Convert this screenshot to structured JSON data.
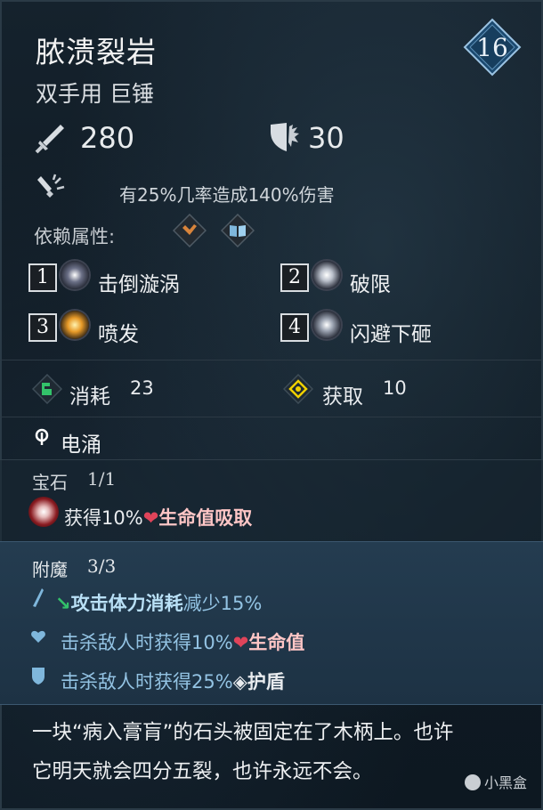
{
  "item": {
    "name": "脓溃裂岩",
    "type": "双手用 巨锤",
    "level": "16",
    "damage": "280",
    "guard": "30",
    "effect_text": "有25%几率造成140%伤害",
    "dependency_label": "依赖属性:",
    "dependency_icons": [
      "strength-icon",
      "book-icon"
    ]
  },
  "skills": [
    {
      "num": "1",
      "name": "击倒漩涡",
      "icon": "vortex-icon"
    },
    {
      "num": "2",
      "name": "破限",
      "icon": "limit-break-icon"
    },
    {
      "num": "3",
      "name": "喷发",
      "icon": "eruption-icon"
    },
    {
      "num": "4",
      "name": "闪避下砸",
      "icon": "dodge-slam-icon"
    }
  ],
  "resources": {
    "cost_label": "消耗",
    "cost_value": "23",
    "gain_label": "获取",
    "gain_value": "10"
  },
  "perk": {
    "name": "电涌",
    "icon": "surge-icon"
  },
  "gem": {
    "label": "宝石",
    "count": "1/1",
    "effect_prefix": "获得10%",
    "effect_highlight": "生命值吸取"
  },
  "enchant": {
    "label": "附魔",
    "count": "3/3",
    "lines": [
      {
        "highlight": "攻击体力消耗",
        "suffix": "减少15%"
      },
      {
        "prefix": "击杀敌人时获得10%",
        "highlight": "生命值"
      },
      {
        "prefix": "击杀敌人时获得25%",
        "highlight": "护盾"
      }
    ]
  },
  "flavor": {
    "line1": "一块“病入膏肓”的石头被固定在了木柄上。也许",
    "line2": "它明天就会四分五裂，也许永远不会。"
  },
  "watermark": "小黑盒",
  "colors": {
    "background": "#101b24",
    "enchant_band": "#21384a",
    "enchant_text": "#93c3e3",
    "heart": "#e0445a",
    "gain_icon": "#f0d000"
  }
}
